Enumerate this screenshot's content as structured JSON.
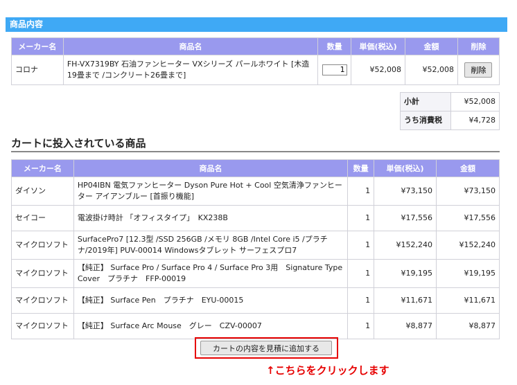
{
  "section": {
    "title": "商品内容"
  },
  "product_table": {
    "headers": [
      "メーカー名",
      "商品名",
      "数量",
      "単価(税込)",
      "金額",
      "削除"
    ],
    "row": {
      "maker": "コロナ",
      "name": "FH-VX7319BY 石油ファンヒーター VXシリーズ パールホワイト [木造19畳まで /コンクリート26畳まで]",
      "qty": "1",
      "unit_price": "¥52,008",
      "amount": "¥52,008",
      "delete_label": "削除"
    }
  },
  "summary": {
    "subtotal_label": "小計",
    "subtotal_value": "¥52,008",
    "tax_label": "うち消費税",
    "tax_value": "¥4,728"
  },
  "cart": {
    "heading": "カートに投入されている商品",
    "headers": [
      "メーカー名",
      "商品名",
      "数量",
      "単価(税込)",
      "金額"
    ],
    "rows": [
      {
        "maker": "ダイソン",
        "name": "HP04IBN 電気ファンヒーター Dyson Pure Hot + Cool 空気清浄ファンヒーター アイアンブルー [首振り機能]",
        "qty": "1",
        "unit_price": "¥73,150",
        "amount": "¥73,150"
      },
      {
        "maker": "セイコー",
        "name": "電波掛け時計 「オフィスタイプ」　KX238B",
        "qty": "1",
        "unit_price": "¥17,556",
        "amount": "¥17,556"
      },
      {
        "maker": "マイクロソフト",
        "name": "SurfacePro7 [12.3型 /SSD 256GB /メモリ 8GB /Intel Core i5 /プラチナ/2019年] PUV-00014 Windowsタブレット サーフェスプロ7",
        "qty": "1",
        "unit_price": "¥152,240",
        "amount": "¥152,240"
      },
      {
        "maker": "マイクロソフト",
        "name": "【純正】 Surface Pro / Surface Pro 4 / Surface Pro 3用　Signature Type Cover　プラチナ　FFP-00019",
        "qty": "1",
        "unit_price": "¥19,195",
        "amount": "¥19,195"
      },
      {
        "maker": "マイクロソフト",
        "name": "【純正】 Surface Pen　プラチナ　EYU-00015",
        "qty": "1",
        "unit_price": "¥11,671",
        "amount": "¥11,671"
      },
      {
        "maker": "マイクロソフト",
        "name": "【純正】 Surface Arc Mouse　グレー　CZV-00007",
        "qty": "1",
        "unit_price": "¥8,877",
        "amount": "¥8,877"
      }
    ]
  },
  "add_button_label": "カートの内容を見積に追加する",
  "hint_text": "↑こちらをクリックします",
  "colors": {
    "section_bar": "#3fa9f5",
    "header": "#9999ee",
    "highlight": "#e60000"
  }
}
